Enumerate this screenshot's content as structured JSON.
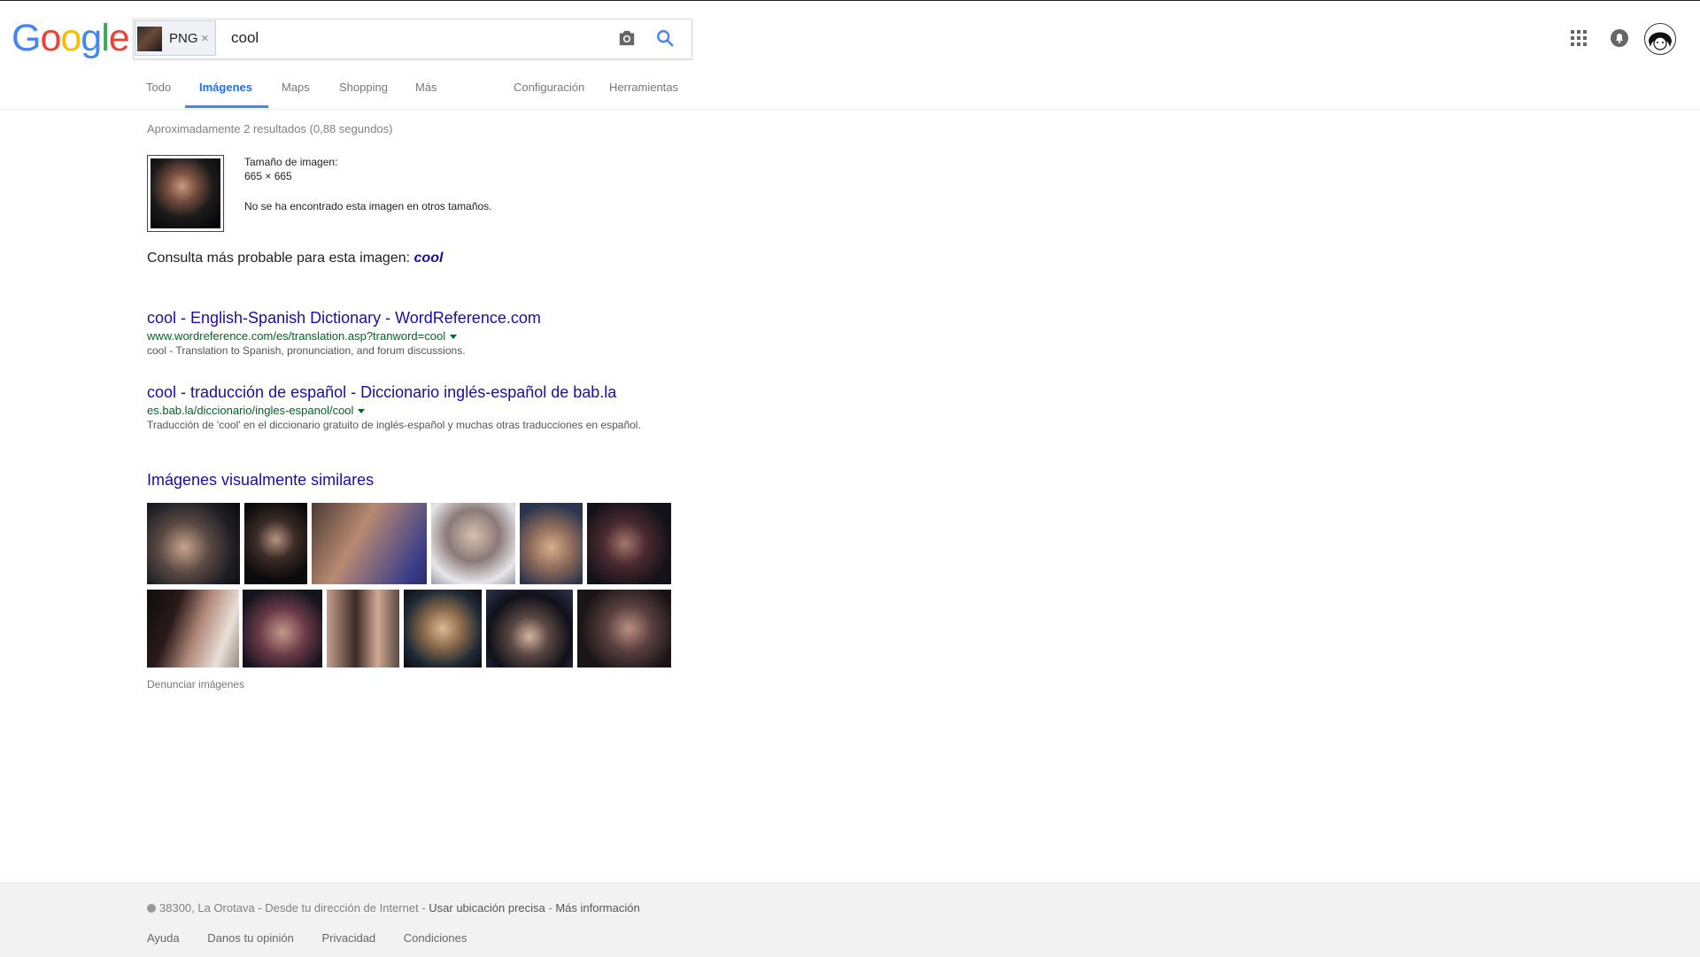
{
  "header": {
    "logo": "Google",
    "logo_colors": [
      "#4285f4",
      "#ea4335",
      "#fbbc05",
      "#4285f4",
      "#34a853",
      "#ea4335"
    ],
    "search": {
      "chip_label": "PNG",
      "chip_close": "×",
      "query": "cool"
    },
    "icons": [
      "camera-icon",
      "search-icon",
      "apps-icon",
      "notifications-icon",
      "avatar"
    ]
  },
  "tabs": [
    {
      "label": "Todo",
      "active": false
    },
    {
      "label": "Imágenes",
      "active": true
    },
    {
      "label": "Maps",
      "active": false
    },
    {
      "label": "Shopping",
      "active": false
    },
    {
      "label": "Más",
      "active": false
    },
    {
      "label": "Configuración",
      "active": false
    },
    {
      "label": "Herramientas",
      "active": false
    }
  ],
  "results_stats": "Aproximadamente 2 resultados (0,88 segundos)",
  "image_info": {
    "size_label": "Tamaño de imagen:",
    "size_value": "665 × 665",
    "no_other_sizes": "No se ha encontrado esta imagen en otros tamaños."
  },
  "best_guess": {
    "prefix": "Consulta más probable para esta imagen:",
    "term": "cool"
  },
  "results": [
    {
      "title": "cool - English-Spanish Dictionary - WordReference.com",
      "url": "www.wordreference.com/es/translation.asp?tranword=cool",
      "snippet": "cool - Translation to Spanish, pronunciation, and forum discussions."
    },
    {
      "title": "cool - traducción de español - Diccionario inglés-español de bab.la",
      "url": "es.bab.la/diccionario/ingles-espanol/cool",
      "snippet": "Traducción de 'cool' en el diccionario gratuito de inglés-español y muchas otras traducciones en español."
    }
  ],
  "similar": {
    "title": "Imágenes visualmente similares",
    "report": "Denunciar imágenes"
  },
  "footer": {
    "location": "38300, La Orotava",
    "location_source": "Desde tu dirección de Internet",
    "precise": "Usar ubicación precisa",
    "more_info": "Más información",
    "links": [
      "Ayuda",
      "Danos tu opinión",
      "Privacidad",
      "Condiciones"
    ]
  },
  "colors": {
    "link": "#1a0dab",
    "url_green": "#006621",
    "active_tab": "#1a73e8",
    "footer_bg": "#f2f2f2"
  }
}
